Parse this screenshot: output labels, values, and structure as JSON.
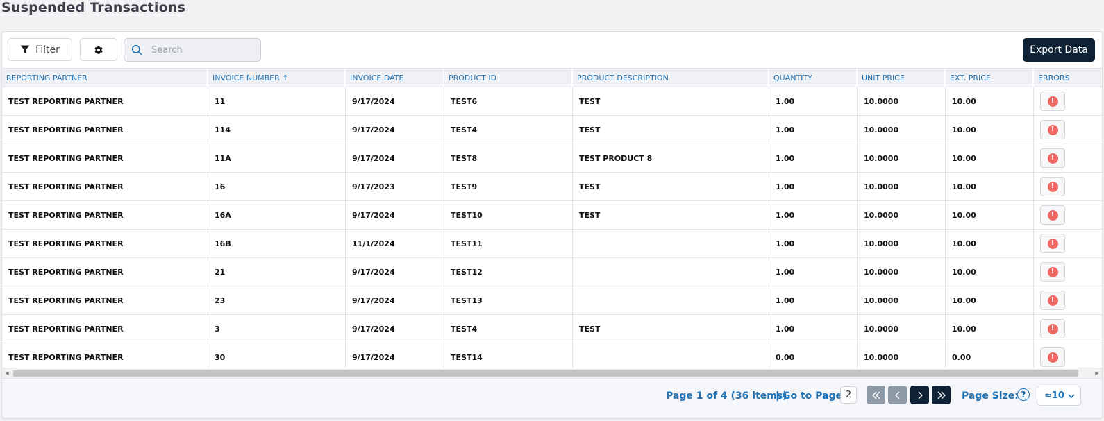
{
  "page": {
    "title": "Suspended Transactions"
  },
  "toolbar": {
    "filter_label": "Filter",
    "search_placeholder": "Search",
    "search_value": "",
    "export_label": "Export Data"
  },
  "table": {
    "columns": [
      {
        "key": "partner",
        "label": "REPORTING PARTNER"
      },
      {
        "key": "invoice_number",
        "label": "INVOICE NUMBER ↑"
      },
      {
        "key": "invoice_date",
        "label": "INVOICE DATE"
      },
      {
        "key": "product_id",
        "label": "PRODUCT ID"
      },
      {
        "key": "product_description",
        "label": "PRODUCT DESCRIPTION"
      },
      {
        "key": "quantity",
        "label": "QUANTITY"
      },
      {
        "key": "unit_price",
        "label": "UNIT PRICE"
      },
      {
        "key": "ext_price",
        "label": "EXT. PRICE"
      },
      {
        "key": "errors",
        "label": "ERRORS"
      }
    ],
    "rows": [
      {
        "partner": "TEST REPORTING PARTNER",
        "invoice_number": "11",
        "invoice_date": "9/17/2024",
        "product_id": "TEST6",
        "product_description": "TEST",
        "quantity": "1.00",
        "unit_price": "10.0000",
        "ext_price": "10.00"
      },
      {
        "partner": "TEST REPORTING PARTNER",
        "invoice_number": "114",
        "invoice_date": "9/17/2024",
        "product_id": "TEST4",
        "product_description": "TEST",
        "quantity": "1.00",
        "unit_price": "10.0000",
        "ext_price": "10.00"
      },
      {
        "partner": "TEST REPORTING PARTNER",
        "invoice_number": "11A",
        "invoice_date": "9/17/2024",
        "product_id": "TEST8",
        "product_description": "TEST PRODUCT 8",
        "quantity": "1.00",
        "unit_price": "10.0000",
        "ext_price": "10.00"
      },
      {
        "partner": "TEST REPORTING PARTNER",
        "invoice_number": "16",
        "invoice_date": "9/17/2023",
        "product_id": "TEST9",
        "product_description": "TEST",
        "quantity": "1.00",
        "unit_price": "10.0000",
        "ext_price": "10.00"
      },
      {
        "partner": "TEST REPORTING PARTNER",
        "invoice_number": "16A",
        "invoice_date": "9/17/2024",
        "product_id": "TEST10",
        "product_description": "TEST",
        "quantity": "1.00",
        "unit_price": "10.0000",
        "ext_price": "10.00"
      },
      {
        "partner": "TEST REPORTING PARTNER",
        "invoice_number": "16B",
        "invoice_date": "11/1/2024",
        "product_id": "TEST11",
        "product_description": "",
        "quantity": "1.00",
        "unit_price": "10.0000",
        "ext_price": "10.00"
      },
      {
        "partner": "TEST REPORTING PARTNER",
        "invoice_number": "21",
        "invoice_date": "9/17/2024",
        "product_id": "TEST12",
        "product_description": "",
        "quantity": "1.00",
        "unit_price": "10.0000",
        "ext_price": "10.00"
      },
      {
        "partner": "TEST REPORTING PARTNER",
        "invoice_number": "23",
        "invoice_date": "9/17/2024",
        "product_id": "TEST13",
        "product_description": "",
        "quantity": "1.00",
        "unit_price": "10.0000",
        "ext_price": "10.00"
      },
      {
        "partner": "TEST REPORTING PARTNER",
        "invoice_number": "3",
        "invoice_date": "9/17/2024",
        "product_id": "TEST4",
        "product_description": "TEST",
        "quantity": "1.00",
        "unit_price": "10.0000",
        "ext_price": "10.00"
      },
      {
        "partner": "TEST REPORTING PARTNER",
        "invoice_number": "30",
        "invoice_date": "9/17/2024",
        "product_id": "TEST14",
        "product_description": "",
        "quantity": "0.00",
        "unit_price": "10.0000",
        "ext_price": "0.00"
      }
    ],
    "error_icon": "exclamation-circle-icon"
  },
  "pager": {
    "summary": "Page 1 of 4 (36 items)",
    "goto_label": "| Go to Page:",
    "goto_value": "2",
    "page_size_label": "Page Size:",
    "page_size_value": "≈10"
  },
  "colors": {
    "accent": "#1f73b7",
    "dark": "#0f2235",
    "error": "#ef6a64"
  }
}
